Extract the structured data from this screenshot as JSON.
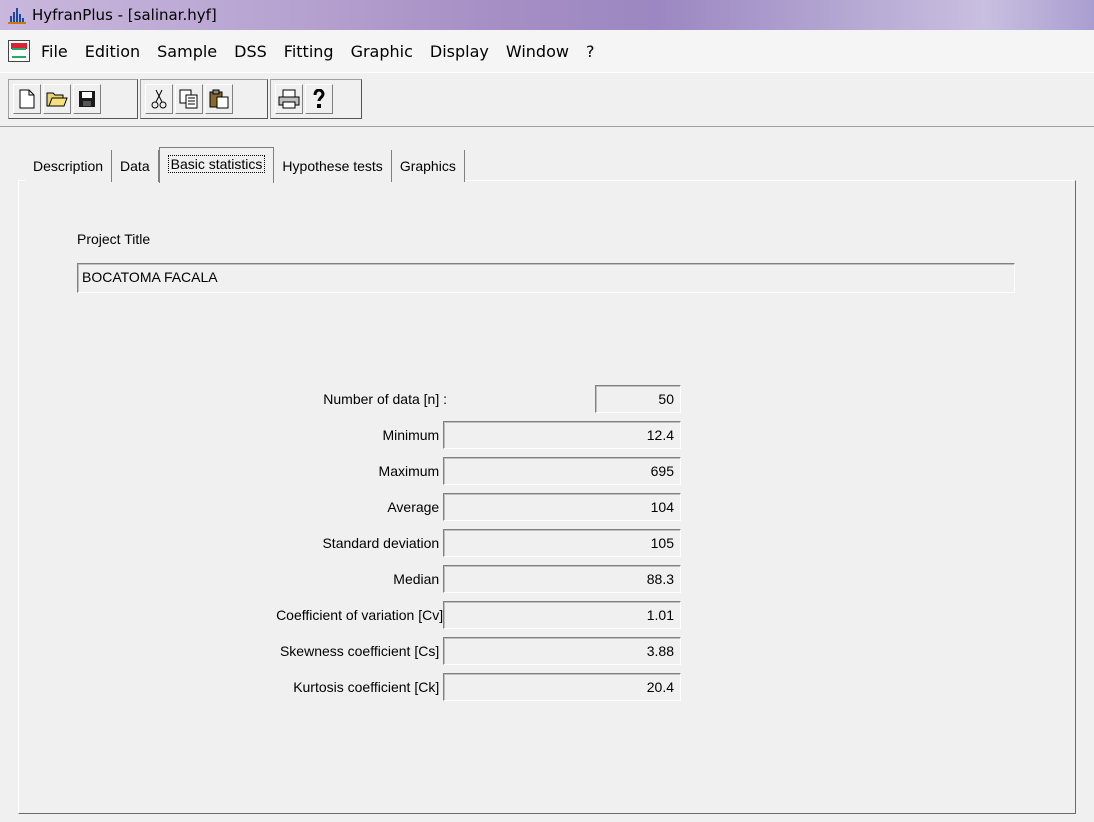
{
  "window": {
    "title": "HyfranPlus - [salinar.hyf]"
  },
  "menu": [
    "File",
    "Edition",
    "Sample",
    "DSS",
    "Fitting",
    "Graphic",
    "Display",
    "Window",
    "?"
  ],
  "toolbar": {
    "groups": [
      [
        "new-file-icon",
        "open-folder-icon",
        "save-icon"
      ],
      [
        "cut-icon",
        "copy-icon",
        "paste-icon"
      ],
      [
        "print-icon",
        "help-icon"
      ]
    ]
  },
  "tabs": [
    "Description",
    "Data",
    "Basic statistics",
    "Hypothese tests",
    "Graphics"
  ],
  "active_tab": "Basic statistics",
  "project": {
    "label": "Project Title",
    "value": "BOCATOMA FACALA"
  },
  "stats": [
    {
      "label": "Number of data [n] :",
      "value": "50"
    },
    {
      "label": "Minimum :",
      "value": "12.4"
    },
    {
      "label": "Maximum :",
      "value": "695"
    },
    {
      "label": "Average :",
      "value": "104"
    },
    {
      "label": "Standard deviation :",
      "value": "105"
    },
    {
      "label": "Median :",
      "value": "88.3"
    },
    {
      "label": "Coefficient of variation [Cv]:",
      "value": "1.01"
    },
    {
      "label": "Skewness coefficient [Cs] :",
      "value": "3.88"
    },
    {
      "label": "Kurtosis coefficient [Ck] :",
      "value": "20.4"
    }
  ]
}
